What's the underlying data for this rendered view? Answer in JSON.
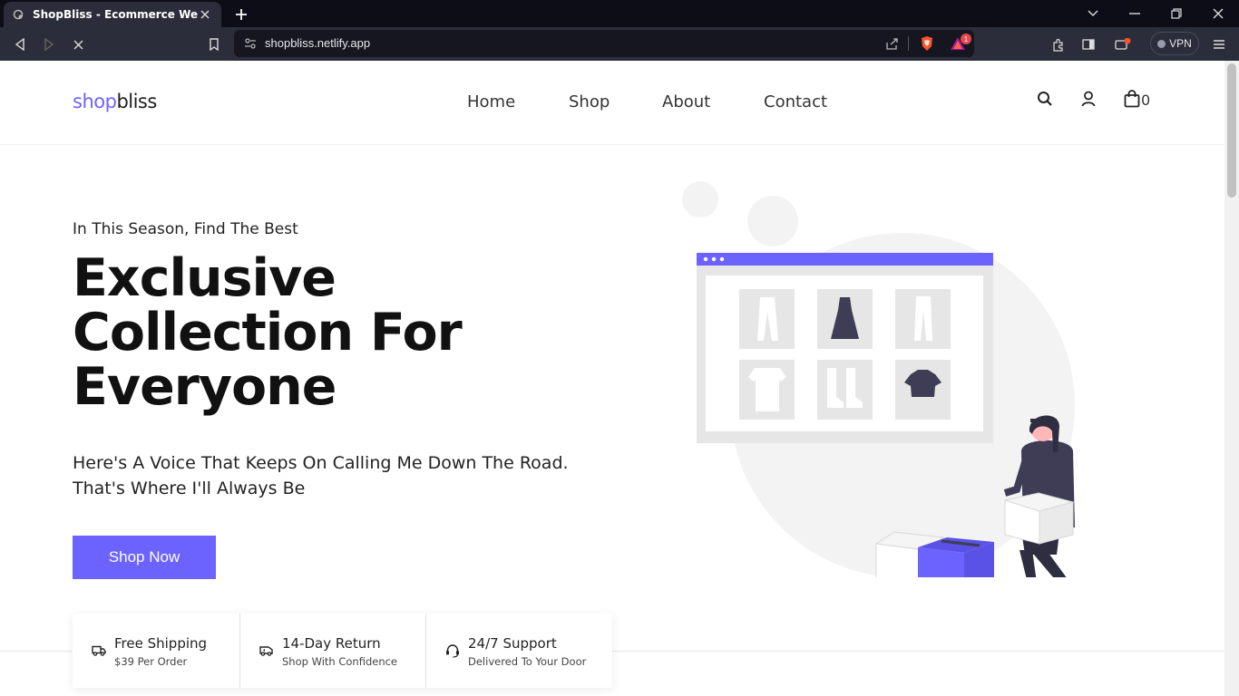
{
  "browser": {
    "tab_title": "ShopBliss - Ecommerce Website",
    "url": "shopbliss.netlify.app",
    "vpn_label": "VPN",
    "notification_count": "1"
  },
  "site": {
    "logo_part1": "shop",
    "logo_part2": "bliss",
    "nav": [
      "Home",
      "Shop",
      "About",
      "Contact"
    ],
    "cart_count": "0",
    "brand_color": "#6c63ff"
  },
  "hero": {
    "eyebrow": "In This Season, Find The Best",
    "headline_line1": "Exclusive",
    "headline_line2": "Collection For",
    "headline_line3": "Everyone",
    "subtext_line1": "Here's A Voice That Keeps On Calling Me Down The Road.",
    "subtext_line2": "That's Where I'll Always Be",
    "cta_label": "Shop Now"
  },
  "features": [
    {
      "title": "Free Shipping",
      "subtitle": "$39 Per Order",
      "icon": "truck-icon"
    },
    {
      "title": "14-Day Return",
      "subtitle": "Shop With Confidence",
      "icon": "return-van-icon"
    },
    {
      "title": "24/7 Support",
      "subtitle": "Delivered To Your Door",
      "icon": "headset-icon"
    }
  ]
}
